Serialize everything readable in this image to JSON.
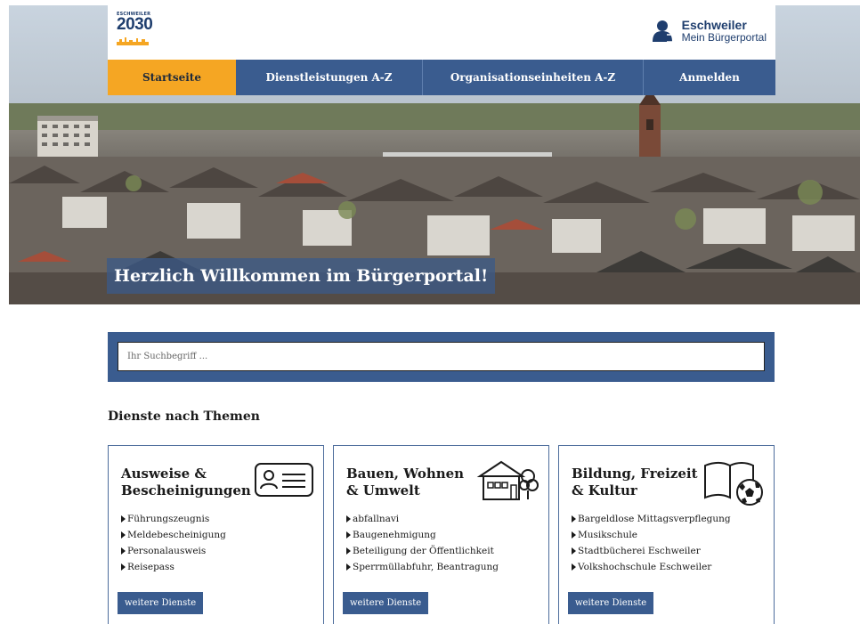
{
  "header": {
    "logo_small_text": "ESCHWEILER",
    "logo_year": "2030",
    "portal_city": "Eschweiler",
    "portal_subtitle": "Mein Bürgerportal"
  },
  "nav": {
    "items": [
      {
        "label": "Startseite",
        "active": true
      },
      {
        "label": "Dienstleistungen A-Z",
        "active": false
      },
      {
        "label": "Organisationseinheiten A-Z",
        "active": false
      },
      {
        "label": "Anmelden",
        "active": false
      }
    ]
  },
  "hero": {
    "welcome_text": "Herzlich Willkommen im Bürgerportal!"
  },
  "search": {
    "placeholder": "Ihr Suchbegriff ..."
  },
  "section": {
    "title": "Dienste nach Themen"
  },
  "cards": [
    {
      "title": "Ausweise & Bescheinigungen",
      "icon": "id-card-icon",
      "links": [
        "Führungszeugnis",
        "Meldebescheinigung",
        "Personalausweis",
        "Reisepass"
      ],
      "more_label": "weitere Dienste"
    },
    {
      "title": "Bauen, Wohnen & Umwelt",
      "icon": "house-tree-icon",
      "links": [
        "abfallnavi",
        "Baugenehmigung",
        "Beteiligung der Öffentlichkeit",
        "Sperrmüllabfuhr, Beantragung"
      ],
      "more_label": "weitere Dienste"
    },
    {
      "title": "Bildung, Freizeit & Kultur",
      "icon": "book-football-icon",
      "links": [
        "Bargeldlose Mittagsverpflegung",
        "Musikschule",
        "Stadtbücherei Eschweiler",
        "Volkshochschule Eschweiler"
      ],
      "more_label": "weitere Dienste"
    }
  ],
  "colors": {
    "primary_blue": "#3a5c8f",
    "active_orange": "#f5a623",
    "dark_text": "#1a1a1a"
  }
}
